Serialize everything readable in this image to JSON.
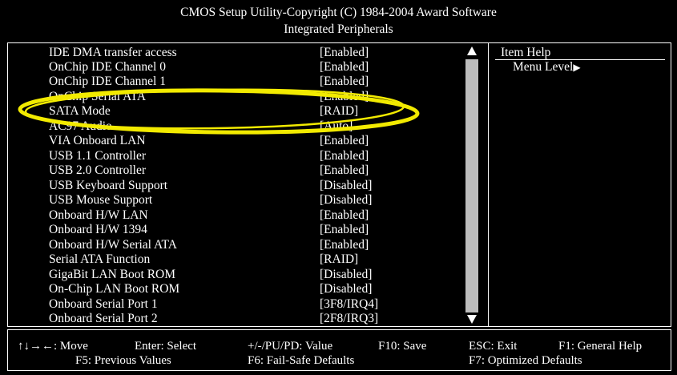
{
  "header": {
    "title": "CMOS Setup Utility-Copyright (C) 1984-2004 Award Software",
    "subtitle": "Integrated Peripherals"
  },
  "settings": [
    {
      "label": "IDE DMA transfer access",
      "value": "[Enabled]"
    },
    {
      "label": "OnChip IDE Channel 0",
      "value": "[Enabled]"
    },
    {
      "label": "OnChip IDE Channel 1",
      "value": "[Enabled]"
    },
    {
      "label": "OnChip Serial ATA",
      "value": "[Enabled]"
    },
    {
      "label": "SATA Mode",
      "value": "[RAID]"
    },
    {
      "label": "AC97 Audio",
      "value": "[Auto]"
    },
    {
      "label": "VIA Onboard LAN",
      "value": "[Enabled]"
    },
    {
      "label": "USB 1.1 Controller",
      "value": "[Enabled]"
    },
    {
      "label": "USB 2.0 Controller",
      "value": "[Enabled]"
    },
    {
      "label": "USB Keyboard Support",
      "value": "[Disabled]"
    },
    {
      "label": "USB Mouse Support",
      "value": "[Disabled]"
    },
    {
      "label": "Onboard H/W LAN",
      "value": "[Enabled]"
    },
    {
      "label": "Onboard H/W 1394",
      "value": "[Enabled]"
    },
    {
      "label": "Onboard H/W Serial ATA",
      "value": "[Enabled]"
    },
    {
      "label": "Serial ATA Function",
      "value": "[RAID]"
    },
    {
      "label": "GigaBit LAN Boot ROM",
      "value": "[Disabled]"
    },
    {
      "label": "On-Chip LAN Boot ROM",
      "value": "[Disabled]"
    },
    {
      "label": "Onboard Serial Port 1",
      "value": "[3F8/IRQ4]"
    },
    {
      "label": "Onboard Serial Port 2",
      "value": "[2F8/IRQ3]"
    }
  ],
  "help": {
    "title": "Item Help",
    "menu_level": "Menu Level"
  },
  "hints": {
    "move": "↑↓→←: Move",
    "enter": "Enter: Select",
    "value": "+/-/PU/PD: Value",
    "save": "F10: Save",
    "exit": "ESC: Exit",
    "general_help": "F1: General Help",
    "previous": "F5: Previous Values",
    "failsafe": "F6: Fail-Safe Defaults",
    "optimized": "F7: Optimized Defaults"
  },
  "colors": {
    "background": "#000000",
    "text": "#ffffff",
    "highlight_ellipse": "#f2ea00",
    "scrollbar_thumb": "#bdbdbd"
  }
}
